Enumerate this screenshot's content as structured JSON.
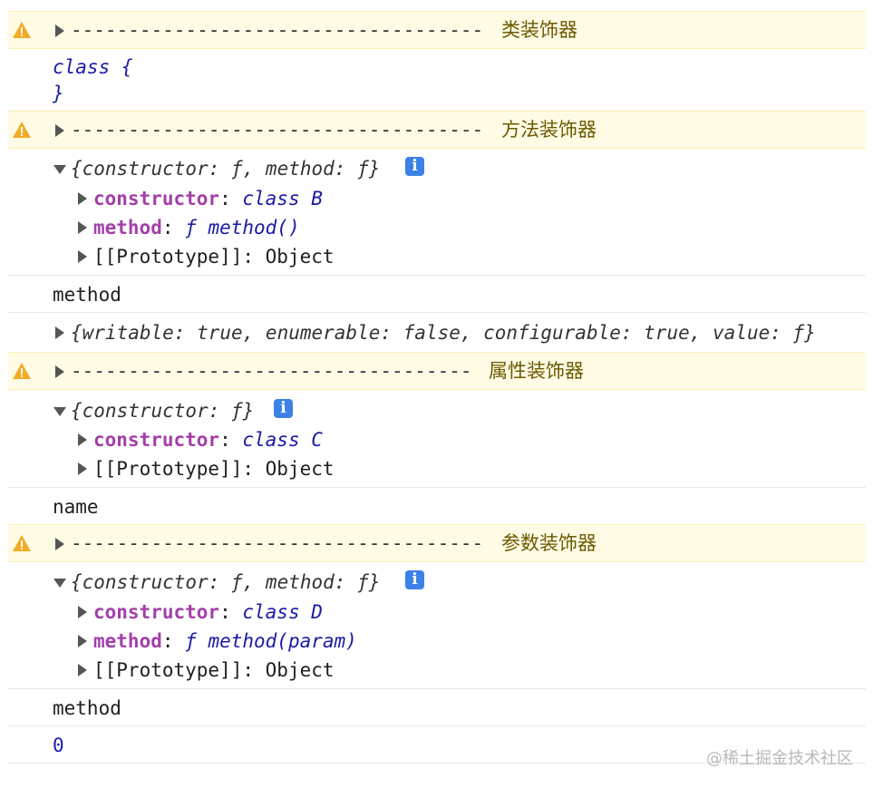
{
  "console": {
    "warn1": {
      "dashes": "------------------------------------",
      "label": "类装饰器"
    },
    "class_log": {
      "line1": "class {",
      "line2": "}"
    },
    "warn2": {
      "dashes": "------------------------------------",
      "label": "方法装饰器"
    },
    "obj1": {
      "summary": "{constructor: ƒ, method: ƒ}",
      "info": "i",
      "props": [
        {
          "key": "constructor",
          "value": "class B"
        },
        {
          "key": "method",
          "value": "ƒ method()"
        }
      ],
      "prototype": "[[Prototype]]: Object"
    },
    "log_method1": "method",
    "descriptor": "{writable: true, enumerable: false, configurable: true, value: ƒ}",
    "warn3": {
      "dashes": "-----------------------------------",
      "label": "属性装饰器"
    },
    "obj2": {
      "summary": "{constructor: ƒ}",
      "info": "i",
      "props": [
        {
          "key": "constructor",
          "value": "class C"
        }
      ],
      "prototype": "[[Prototype]]: Object"
    },
    "log_name": "name",
    "warn4": {
      "dashes": "------------------------------------",
      "label": "参数装饰器"
    },
    "obj3": {
      "summary": "{constructor: ƒ, method: ƒ}",
      "info": "i",
      "props": [
        {
          "key": "constructor",
          "value": "class D"
        },
        {
          "key": "method",
          "value": "ƒ method(param)"
        }
      ],
      "prototype": "[[Prototype]]: Object"
    },
    "log_method2": "method",
    "log_zero": "0"
  },
  "watermark": "@稀土掘金技术社区",
  "icons": {
    "warning": "warning-icon",
    "expand": "triangle-right-icon",
    "collapse": "triangle-down-icon",
    "info": "info-icon"
  },
  "colors": {
    "warning_bg": "#fffbe5",
    "keyword": "#1a1aa6",
    "property": "#a33fa8",
    "info": "#3c82e6"
  }
}
